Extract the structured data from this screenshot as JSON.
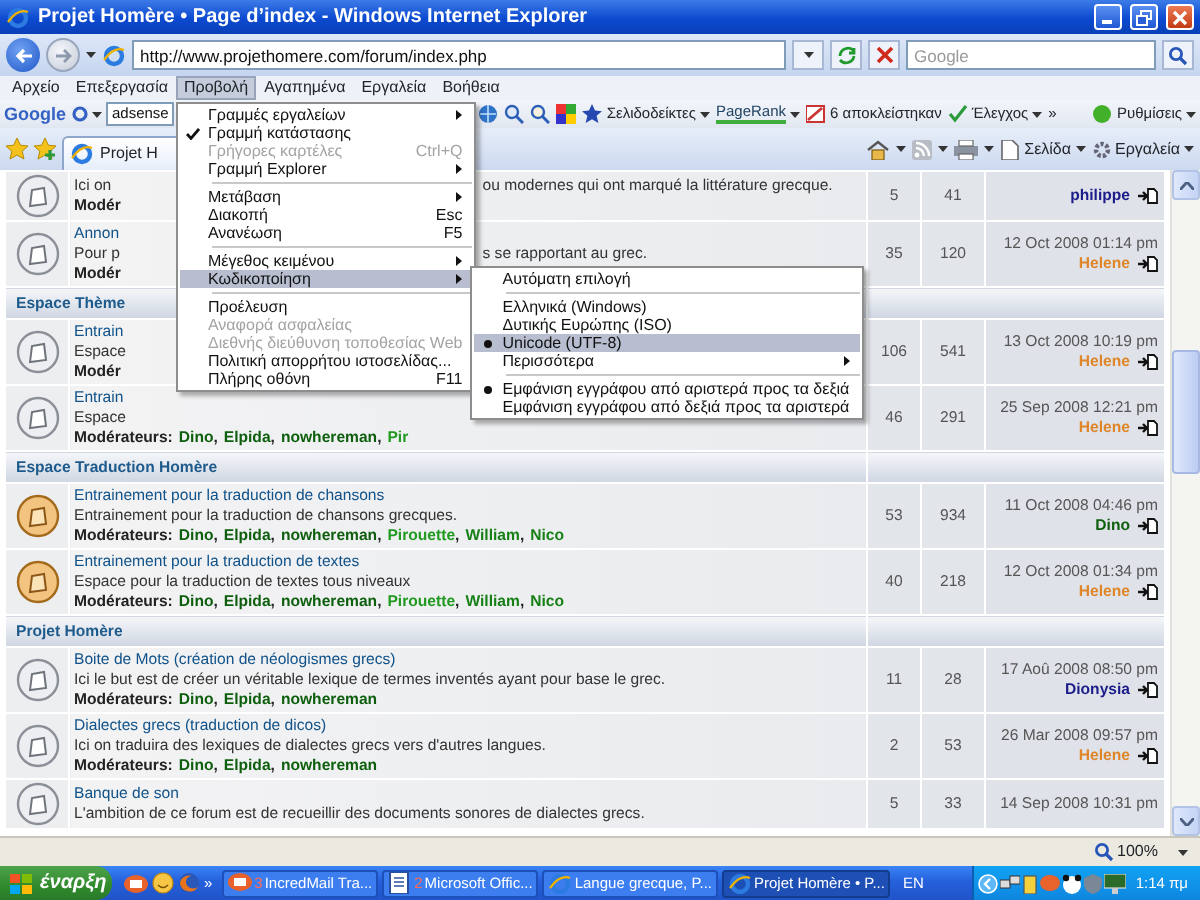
{
  "window": {
    "title": "Projet Homère • Page d’index - Windows Internet Explorer"
  },
  "address_bar": {
    "url": "http://www.projethomere.com/forum/index.php",
    "search_placeholder": "Google"
  },
  "menu_bar": [
    {
      "label": "Αρχείο",
      "selected": false
    },
    {
      "label": "Επεξεργασία",
      "selected": false
    },
    {
      "label": "Προβολή",
      "selected": true
    },
    {
      "label": "Αγαπημένα",
      "selected": false
    },
    {
      "label": "Εργαλεία",
      "selected": false
    },
    {
      "label": "Βοήθεια",
      "selected": false
    }
  ],
  "google_toolbar": {
    "logo": "Google",
    "search_value": "adsense",
    "buttons": [
      "Σελιδοδείκτες",
      "PageRank",
      "6 αποκλείστηκαν",
      "Έλεγχος",
      "»",
      "Ρυθμίσεις"
    ]
  },
  "tab_bar": {
    "tabs": [
      {
        "label": "Projet H",
        "selected": true
      }
    ],
    "commands": [
      "Σελίδα",
      "Εργαλεία"
    ]
  },
  "forum": {
    "sections": [
      {
        "forums": [
          {
            "new_posts": false,
            "description": [
              "Ici on",
              "ou modernes qui ont marqué la littérature grecque."
            ],
            "moderators_label": "Modér",
            "topics": "5",
            "posts": "41",
            "last_post": {
              "author": "philippe",
              "color": "#1c1c8a"
            }
          },
          {
            "new_posts": false,
            "title": [
              "Annon"
            ],
            "description": [
              "Pour p",
              "s se rapportant au grec."
            ],
            "moderators_label": "Modér",
            "topics": "35",
            "posts": "120",
            "last_post": {
              "date": "12 Oct 2008 01:14 pm",
              "author": "Helene",
              "color": "#e0862a"
            }
          }
        ]
      },
      {
        "title": "Espace Thème",
        "forums": [
          {
            "new_posts": false,
            "title": [
              "Entrain"
            ],
            "description": [
              "Espace"
            ],
            "moderators_label": "Modér",
            "topics": "106",
            "posts": "541",
            "last_post": {
              "date": "13 Oct 2008 10:19 pm",
              "author": "Helene",
              "color": "#e0862a"
            }
          },
          {
            "new_posts": false,
            "title": [
              "Entrain"
            ],
            "description": [
              "Espace"
            ],
            "moderators_label": "Modérateurs:",
            "moderators": [
              {
                "name": "Dino",
                "after": ",",
                "color": "#0d5e0d"
              },
              {
                "name": "Elpida",
                "after": ",",
                "color": "#0d5e0d"
              },
              {
                "name": "nowhereman",
                "after": ",",
                "color": "#0d5e0d"
              },
              {
                "name": "Pir",
                "color": "#1f9a1f"
              }
            ],
            "topics": "46",
            "posts": "291",
            "last_post": {
              "date": "25 Sep 2008 12:21 pm",
              "author": "Helene",
              "color": "#e0862a"
            }
          }
        ]
      },
      {
        "title": "Espace Traduction Homère",
        "forums": [
          {
            "new_posts": true,
            "title": [
              "Entrainement pour la traduction de chansons"
            ],
            "description": [
              "Entrainement pour la traduction de chansons grecques."
            ],
            "moderators_label": "Modérateurs:",
            "moderators": [
              {
                "name": "Dino",
                "after": ",",
                "color": "#0d5e0d"
              },
              {
                "name": "Elpida",
                "after": ",",
                "color": "#0d5e0d"
              },
              {
                "name": "nowhereman",
                "after": ",",
                "color": "#0d5e0d"
              },
              {
                "name": "Pirouette",
                "after": ",",
                "color": "#1f9a1f"
              },
              {
                "name": "William",
                "after": ",",
                "color": "#178017"
              },
              {
                "name": "Nico",
                "color": "#178017"
              }
            ],
            "topics": "53",
            "posts": "934",
            "last_post": {
              "date": "11 Oct 2008 04:46 pm",
              "author": "Dino",
              "color": "#0d5e0d"
            }
          },
          {
            "new_posts": true,
            "title": [
              "Entrainement pour la traduction de textes"
            ],
            "description": [
              "Espace pour la traduction de textes tous niveaux"
            ],
            "moderators_label": "Modérateurs:",
            "moderators": [
              {
                "name": "Dino",
                "after": ",",
                "color": "#0d5e0d"
              },
              {
                "name": "Elpida",
                "after": ",",
                "color": "#0d5e0d"
              },
              {
                "name": "nowhereman",
                "after": ",",
                "color": "#0d5e0d"
              },
              {
                "name": "Pirouette",
                "after": ",",
                "color": "#1f9a1f"
              },
              {
                "name": "William",
                "after": ",",
                "color": "#178017"
              },
              {
                "name": "Nico",
                "color": "#178017"
              }
            ],
            "topics": "40",
            "posts": "218",
            "last_post": {
              "date": "12 Oct 2008 01:34 pm",
              "author": "Helene",
              "color": "#e0862a"
            }
          }
        ]
      },
      {
        "title": "Projet Homère",
        "forums": [
          {
            "new_posts": false,
            "title": [
              "Boite de Mots (création de néologismes grecs)"
            ],
            "description": [
              "Ici le but est de créer un véritable lexique de termes inventés ayant pour base le grec."
            ],
            "moderators_label": "Modérateurs:",
            "moderators": [
              {
                "name": "Dino",
                "after": ",",
                "color": "#0d5e0d"
              },
              {
                "name": "Elpida",
                "after": ",",
                "color": "#0d5e0d"
              },
              {
                "name": "nowhereman",
                "color": "#0d5e0d"
              }
            ],
            "topics": "11",
            "posts": "28",
            "last_post": {
              "date": "17 Aoû 2008 08:50 pm",
              "author": "Dionysia",
              "color": "#1c1c8a"
            }
          },
          {
            "new_posts": false,
            "title": [
              "Dialectes grecs (traduction de dicos)"
            ],
            "description": [
              "Ici on traduira des lexiques de dialectes grecs vers d'autres langues."
            ],
            "moderators_label": "Modérateurs:",
            "moderators": [
              {
                "name": "Dino",
                "after": ",",
                "color": "#0d5e0d"
              },
              {
                "name": "Elpida",
                "after": ",",
                "color": "#0d5e0d"
              },
              {
                "name": "nowhereman",
                "color": "#0d5e0d"
              }
            ],
            "topics": "2",
            "posts": "53",
            "last_post": {
              "date": "26 Mar 2008 09:57 pm",
              "author": "Helene",
              "color": "#e0862a"
            }
          },
          {
            "new_posts": false,
            "title": [
              "Banque de son"
            ],
            "description": [
              "L'ambition de ce forum est de recueillir des documents sonores de dialectes grecs."
            ],
            "topics": "5",
            "posts": "33",
            "last_post": {
              "date": "14 Sep 2008 10:31 pm"
            }
          }
        ]
      }
    ]
  },
  "view_menu": {
    "items": [
      {
        "kind": "check",
        "label": "Γραμμές εργαλείων",
        "checked": false,
        "disabled": false,
        "selected": false,
        "submenu": true
      },
      {
        "kind": "check",
        "label": "Γραμμή κατάστασης",
        "checked": true,
        "disabled": false,
        "selected": false,
        "submenu": false
      },
      {
        "kind": "check",
        "label": "Γρήγορες καρτέλες",
        "shortcut": "Ctrl+Q",
        "checked": false,
        "disabled": true,
        "selected": false,
        "submenu": false
      },
      {
        "kind": "check",
        "label": "Γραμμή Explorer",
        "checked": false,
        "disabled": false,
        "selected": false,
        "submenu": true
      },
      {
        "kind": "separator"
      },
      {
        "kind": "check",
        "label": "Μετάβαση",
        "checked": false,
        "disabled": false,
        "selected": false,
        "submenu": true
      },
      {
        "kind": "check",
        "label": "Διακοπή",
        "shortcut": "Esc",
        "checked": false,
        "disabled": false,
        "selected": false,
        "submenu": false
      },
      {
        "kind": "check",
        "label": "Ανανέωση",
        "shortcut": "F5",
        "checked": false,
        "disabled": false,
        "selected": false,
        "submenu": false
      },
      {
        "kind": "separator"
      },
      {
        "kind": "check",
        "label": "Μέγεθος κειμένου",
        "checked": false,
        "disabled": false,
        "selected": false,
        "submenu": true
      },
      {
        "kind": "check",
        "label": "Κωδικοποίηση",
        "checked": false,
        "disabled": false,
        "selected": true,
        "submenu": true
      },
      {
        "kind": "separator"
      },
      {
        "kind": "check",
        "label": "Προέλευση",
        "checked": false,
        "disabled": false,
        "selected": false,
        "submenu": false
      },
      {
        "kind": "check",
        "label": "Αναφορά ασφαλείας",
        "checked": false,
        "disabled": true,
        "selected": false,
        "submenu": false
      },
      {
        "kind": "check",
        "label": "Διεθνής διεύθυνση τοποθεσίας Web",
        "checked": false,
        "disabled": true,
        "selected": false,
        "submenu": false
      },
      {
        "kind": "check",
        "label": "Πολιτική απορρήτου ιστοσελίδας...",
        "checked": false,
        "disabled": false,
        "selected": false,
        "submenu": false
      },
      {
        "kind": "check",
        "label": "Πλήρης οθόνη",
        "shortcut": "F11",
        "checked": false,
        "disabled": false,
        "selected": false,
        "submenu": false
      }
    ]
  },
  "encoding_menu": {
    "items": [
      {
        "kind": "radio",
        "label": "Αυτόματη επιλογή",
        "checked": false,
        "disabled": false,
        "selected": false,
        "submenu": false
      },
      {
        "kind": "separator"
      },
      {
        "kind": "radio",
        "label": "Ελληνικά (Windows)",
        "checked": false,
        "disabled": false,
        "selected": false,
        "submenu": false
      },
      {
        "kind": "radio",
        "label": "Δυτικής Ευρώπης (ISO)",
        "checked": false,
        "disabled": false,
        "selected": false,
        "submenu": false
      },
      {
        "kind": "radio",
        "label": "Unicode (UTF-8)",
        "checked": true,
        "disabled": false,
        "selected": true,
        "submenu": false
      },
      {
        "kind": "radio",
        "label": "Περισσότερα",
        "checked": false,
        "disabled": false,
        "selected": false,
        "submenu": true
      },
      {
        "kind": "separator"
      },
      {
        "kind": "radio",
        "label": "Εμφάνιση εγγράφου από αριστερά προς τα δεξιά",
        "checked": true,
        "disabled": false,
        "selected": false,
        "submenu": false
      },
      {
        "kind": "radio",
        "label": "Εμφάνιση εγγράφου από δεξιά προς τα αριστερά",
        "checked": false,
        "disabled": false,
        "selected": false,
        "submenu": false
      }
    ]
  },
  "status_bar": {
    "zoom": "100%"
  },
  "taskbar": {
    "start": "έναρξη",
    "more": "»",
    "tasks": [
      {
        "count": "3",
        "label": "IncredMail Tra...",
        "selected": false
      },
      {
        "count": "2",
        "label": "Microsoft Offic...",
        "selected": false
      },
      {
        "label": "Langue grecque, P...",
        "selected": false
      },
      {
        "label": "Projet Homère • P...",
        "selected": true
      }
    ],
    "language": "EN",
    "clock": "1:14 πμ"
  }
}
